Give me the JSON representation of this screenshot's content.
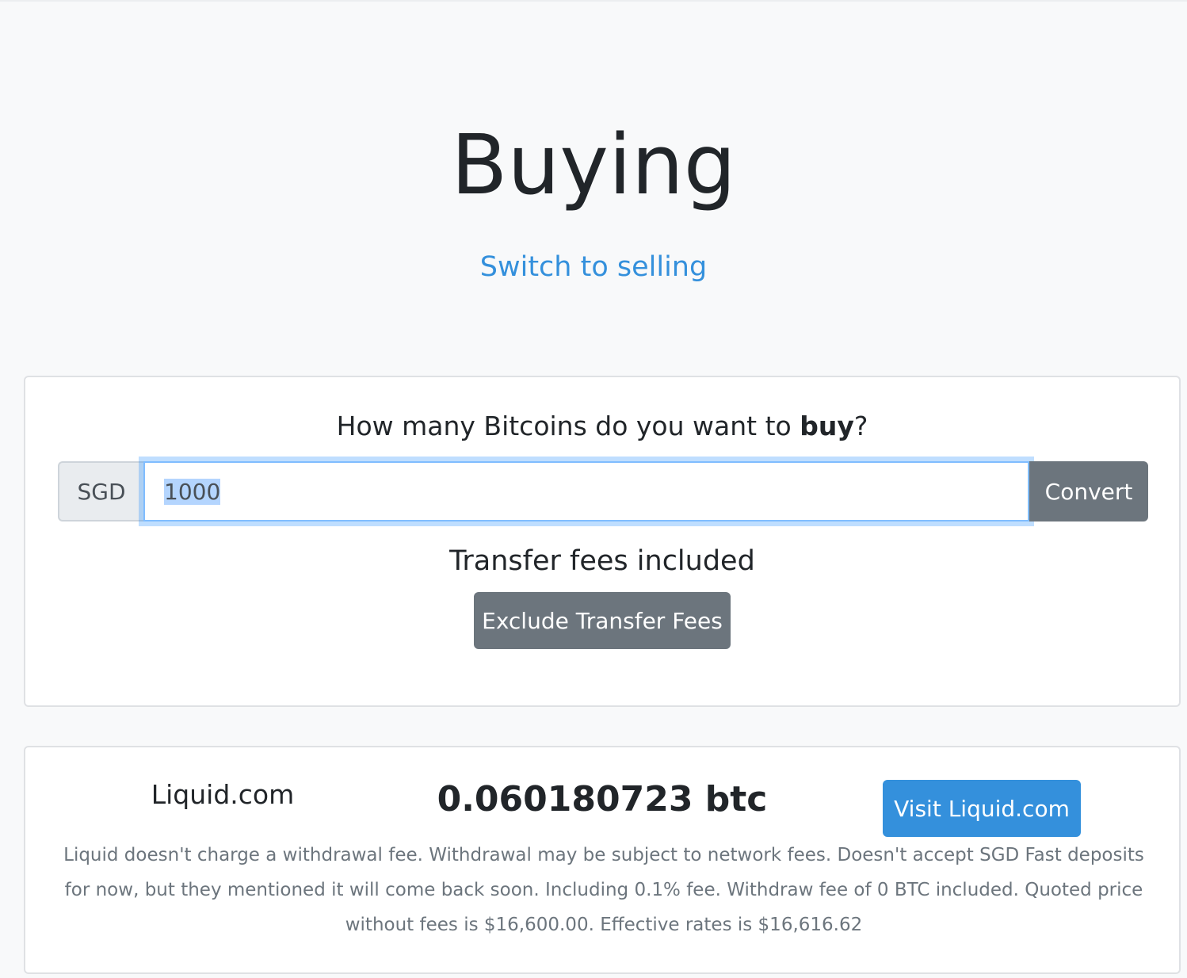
{
  "hero": {
    "title": "Buying",
    "switch_link": "Switch to selling"
  },
  "converter": {
    "question_prefix": "How many Bitcoins do you want to ",
    "question_bold": "buy",
    "question_suffix": "?",
    "currency_label": "SGD",
    "amount_value": "1000",
    "convert_label": "Convert",
    "fees_status": "Transfer fees included",
    "fees_button": "Exclude Transfer Fees"
  },
  "result": {
    "exchange_name": "Liquid.com",
    "btc_amount": "0.060180723 btc",
    "visit_button": "Visit Liquid.com",
    "note": "Liquid doesn't charge a withdrawal fee. Withdrawal may be subject to network fees. Doesn't accept SGD Fast deposits for now, but they mentioned it will come back soon. Including 0.1% fee. Withdraw fee of 0 BTC included. Quoted price without fees is $16,600.00. Effective rates is $16,616.62"
  },
  "colors": {
    "link": "#3490dc",
    "secondary_button": "#6c757d",
    "primary_button": "#3490dc",
    "page_background": "#f8f9fa"
  }
}
